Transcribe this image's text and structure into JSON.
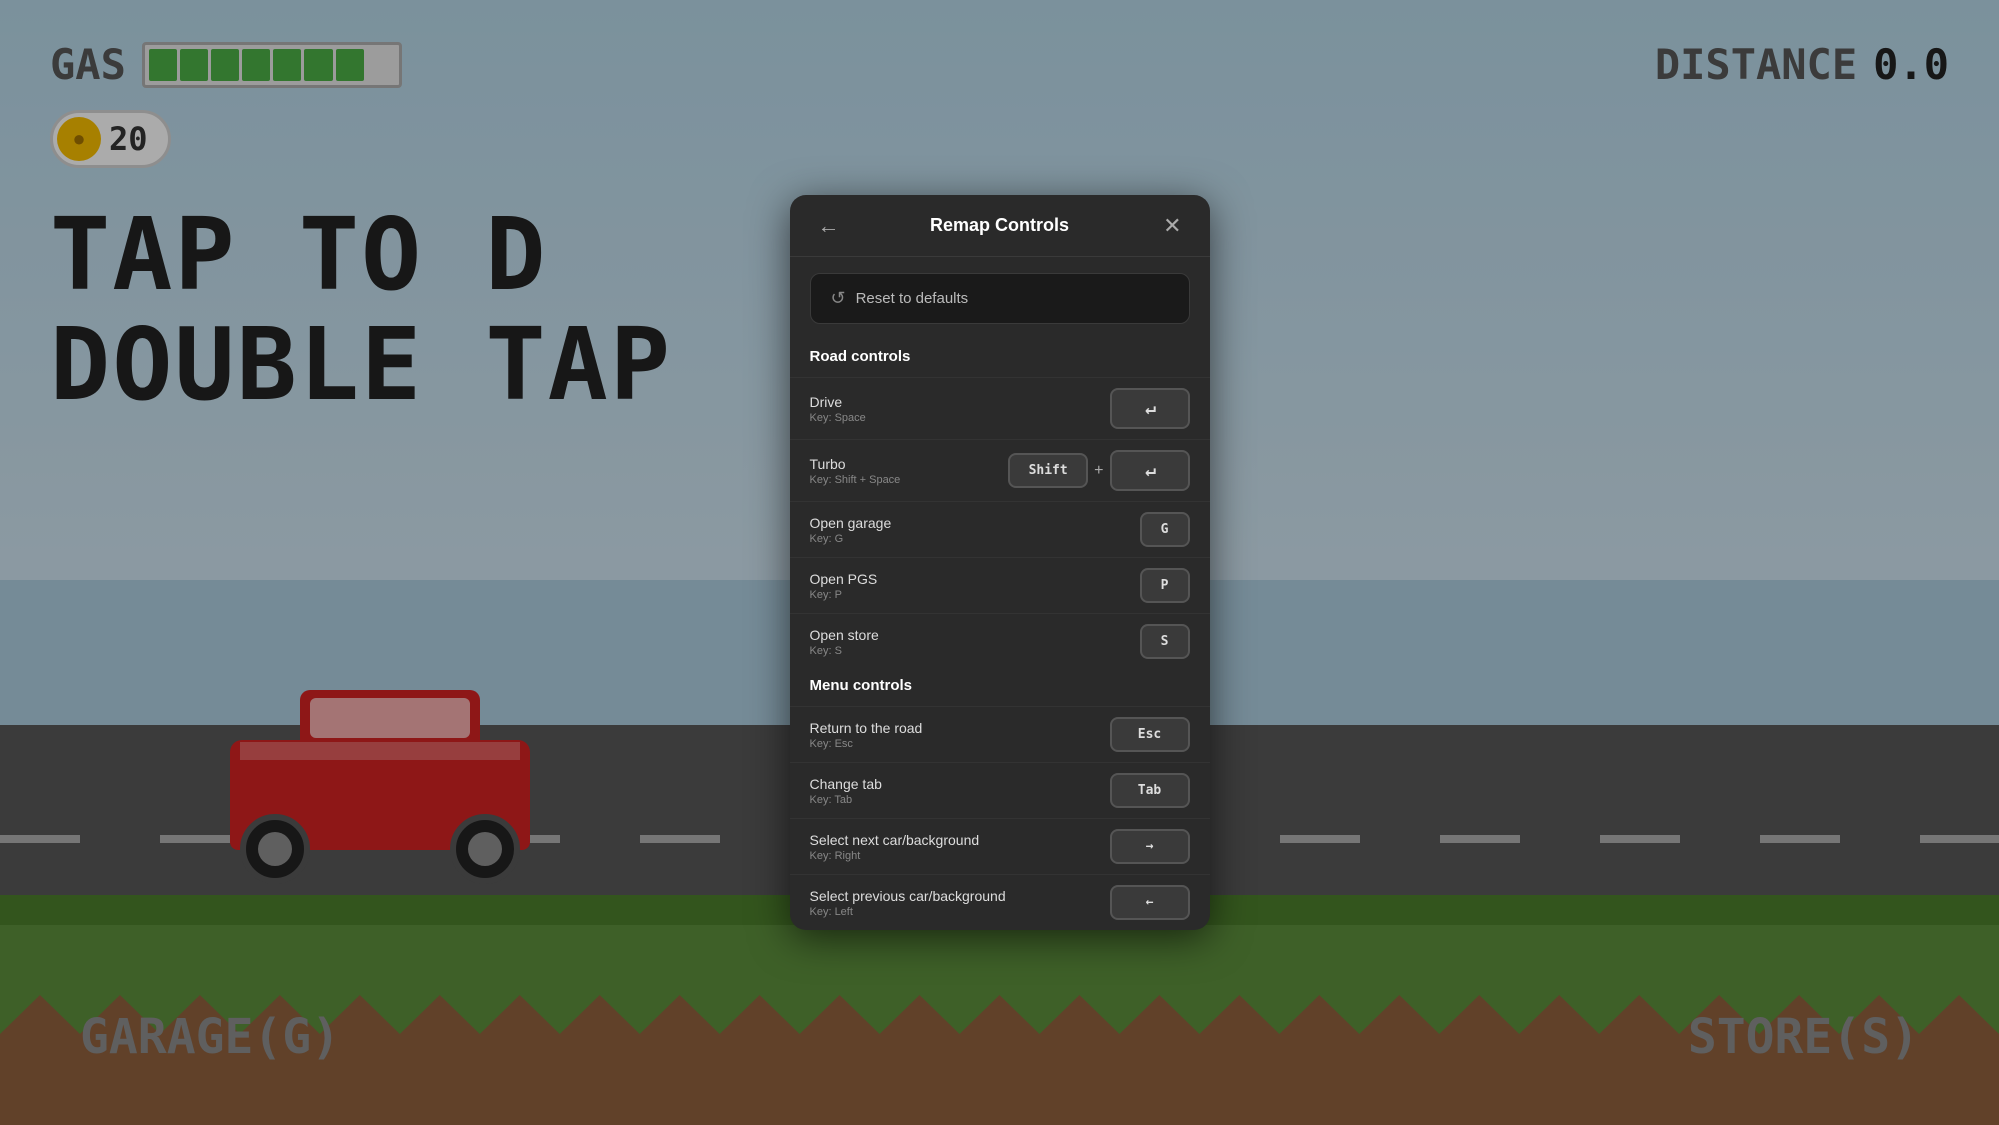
{
  "game": {
    "hud": {
      "gas_label": "GAS",
      "gas_segments": 8,
      "gas_filled": 7,
      "coin_count": "20",
      "distance_label": "DISTANCE",
      "distance_value": "0.0"
    },
    "tap_text_line1": "TAP TO D",
    "tap_text_line2": "DOUBLE TAP",
    "bottom_left": "GARAGE(G)",
    "bottom_right": "STORE(S)"
  },
  "modal": {
    "title": "Remap Controls",
    "back_icon": "←",
    "close_icon": "✕",
    "reset_label": "Reset to defaults",
    "reset_icon": "↺",
    "sections": [
      {
        "id": "road",
        "heading": "Road controls",
        "controls": [
          {
            "id": "drive",
            "name": "Drive",
            "key_hint": "Key: Space",
            "keys": [
              {
                "label": "↵",
                "type": "space"
              }
            ]
          },
          {
            "id": "turbo",
            "name": "Turbo",
            "key_hint": "Key: Shift + Space",
            "keys": [
              {
                "label": "Shift",
                "type": "wide"
              },
              {
                "label": "+",
                "type": "plus"
              },
              {
                "label": "↵",
                "type": "space"
              }
            ]
          },
          {
            "id": "open-garage",
            "name": "Open garage",
            "key_hint": "Key: G",
            "keys": [
              {
                "label": "G",
                "type": "normal"
              }
            ]
          },
          {
            "id": "open-pgs",
            "name": "Open PGS",
            "key_hint": "Key: P",
            "keys": [
              {
                "label": "P",
                "type": "normal"
              }
            ]
          },
          {
            "id": "open-store",
            "name": "Open store",
            "key_hint": "Key: S",
            "keys": [
              {
                "label": "S",
                "type": "normal"
              }
            ]
          }
        ]
      },
      {
        "id": "menu",
        "heading": "Menu controls",
        "controls": [
          {
            "id": "return-road",
            "name": "Return to the road",
            "key_hint": "Key: Esc",
            "keys": [
              {
                "label": "Esc",
                "type": "wide"
              }
            ]
          },
          {
            "id": "change-tab",
            "name": "Change tab",
            "key_hint": "Key: Tab",
            "keys": [
              {
                "label": "Tab",
                "type": "wide"
              }
            ]
          },
          {
            "id": "select-next",
            "name": "Select next car/background",
            "key_hint": "Key: Right",
            "keys": [
              {
                "label": "→",
                "type": "arrow"
              }
            ]
          },
          {
            "id": "select-prev",
            "name": "Select previous car/background",
            "key_hint": "Key: Left",
            "keys": [
              {
                "label": "←",
                "type": "arrow"
              }
            ]
          }
        ]
      }
    ]
  }
}
